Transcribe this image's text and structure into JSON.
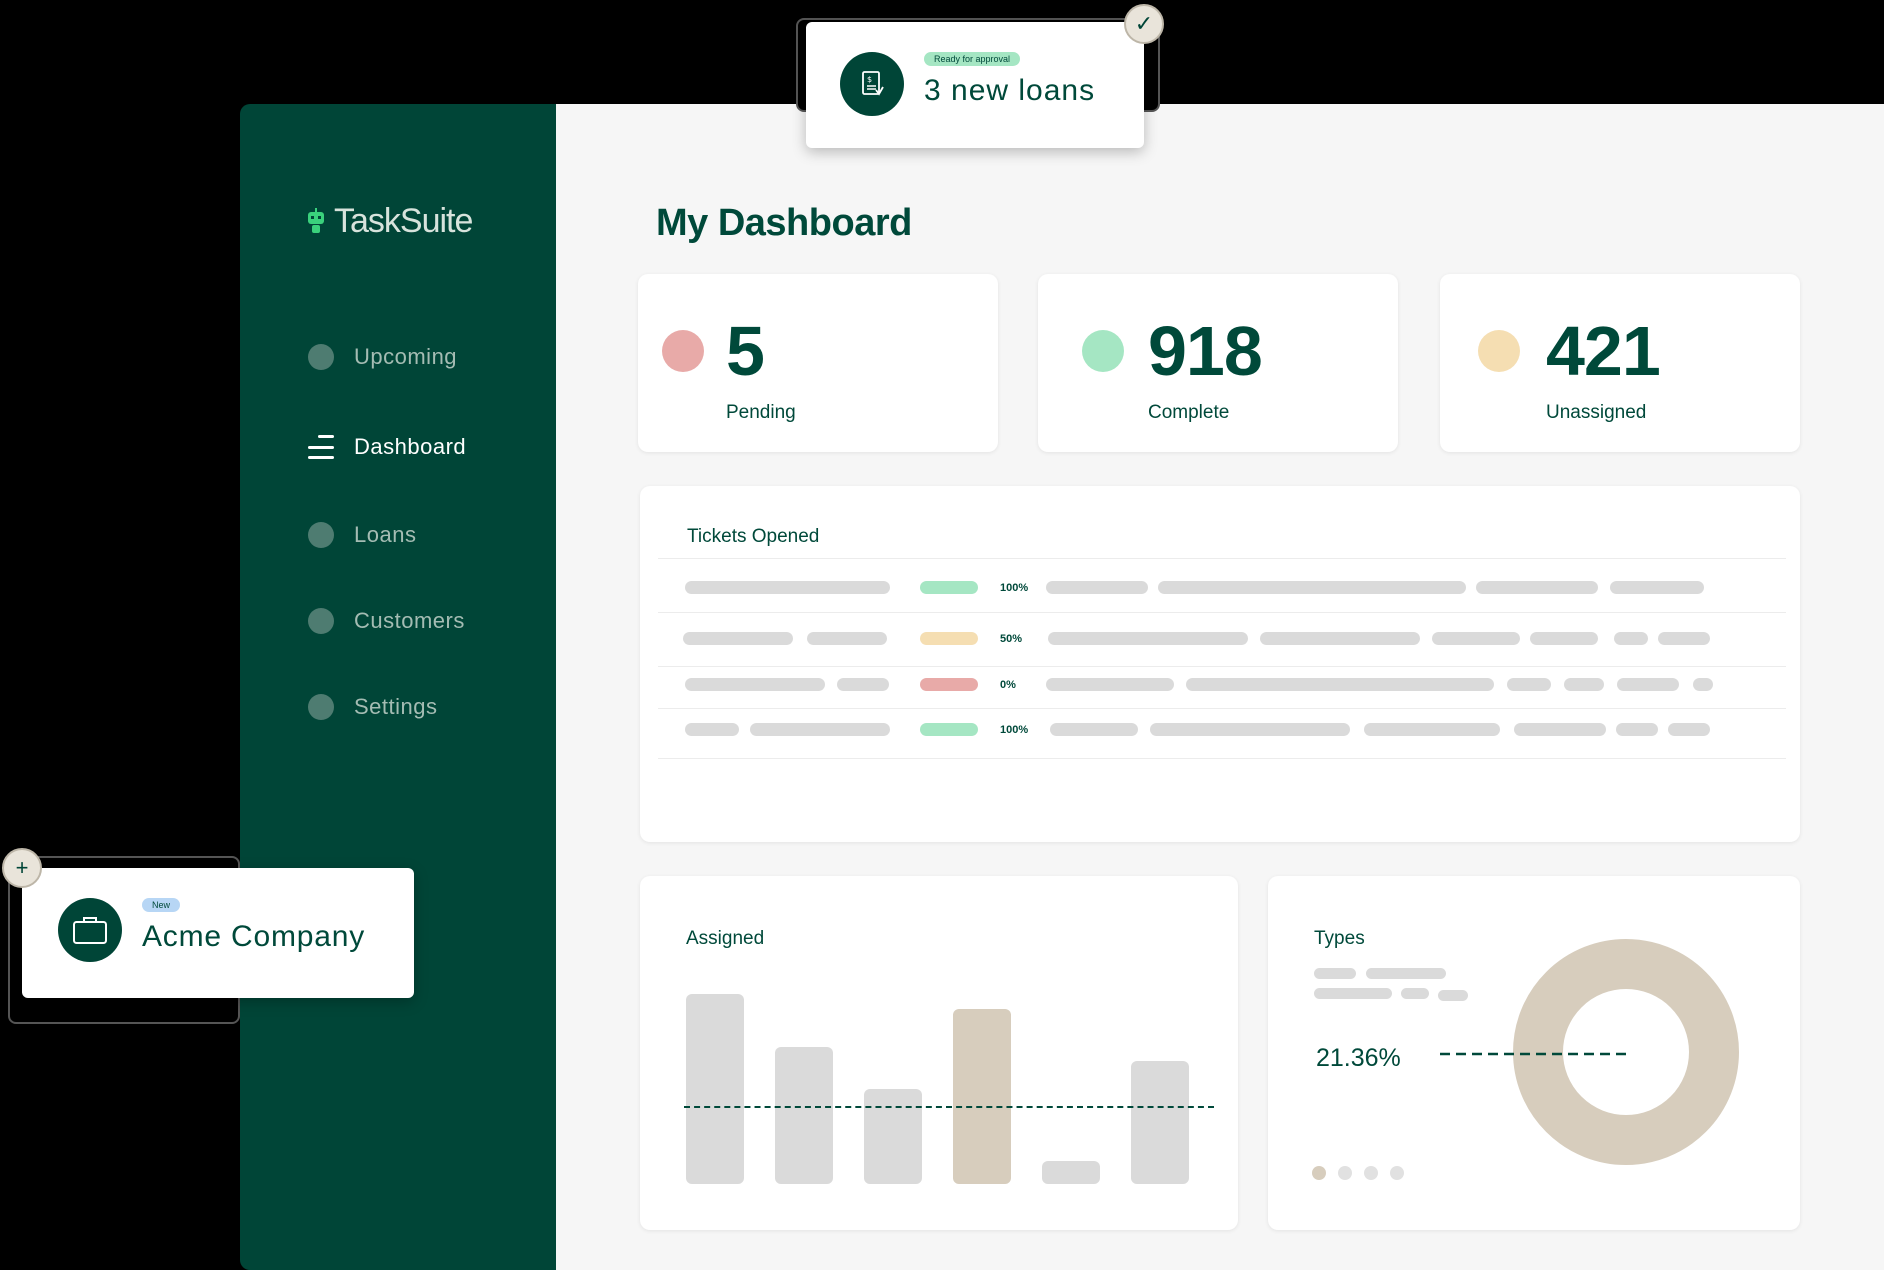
{
  "app": {
    "name": "TaskSuite"
  },
  "sidebar": {
    "items": [
      {
        "label": "Upcoming",
        "active": false
      },
      {
        "label": "Dashboard",
        "active": true
      },
      {
        "label": "Loans",
        "active": false
      },
      {
        "label": "Customers",
        "active": false
      },
      {
        "label": "Settings",
        "active": false
      }
    ]
  },
  "main": {
    "title": "My Dashboard",
    "stats": [
      {
        "value": "5",
        "label": "Pending",
        "color": "#e8aaa8"
      },
      {
        "value": "918",
        "label": "Complete",
        "color": "#a5e6c3"
      },
      {
        "value": "421",
        "label": "Unassigned",
        "color": "#f5deb2"
      }
    ],
    "tickets": {
      "title": "Tickets Opened",
      "rows": [
        {
          "percent": "100%",
          "status_color": "#a5e6c3"
        },
        {
          "percent": "50%",
          "status_color": "#f5deb2"
        },
        {
          "percent": "0%",
          "status_color": "#e8aaa8"
        },
        {
          "percent": "100%",
          "status_color": "#a5e6c3"
        }
      ]
    },
    "assigned": {
      "title": "Assigned"
    },
    "types": {
      "title": "Types",
      "value": "21.36%"
    }
  },
  "popups": {
    "loans": {
      "badge": "Ready for approval",
      "text": "3 new loans",
      "icon": "loan-document-icon",
      "action_icon": "check-icon"
    },
    "company": {
      "badge": "New",
      "text": "Acme Company",
      "icon": "briefcase-icon",
      "action_icon": "plus-icon"
    }
  },
  "colors": {
    "brand": "#004537",
    "text": "#00493a",
    "donut": "#d7cdbd"
  },
  "chart_data": [
    {
      "type": "bar",
      "title": "Assigned",
      "values": [
        100,
        72,
        50,
        92,
        12,
        65
      ],
      "highlighted_index": 3,
      "reference_line": 41,
      "ylim": [
        0,
        100
      ]
    },
    {
      "type": "pie",
      "title": "Types",
      "annotation": "21.36%",
      "values": [
        100
      ],
      "donut": true
    }
  ]
}
